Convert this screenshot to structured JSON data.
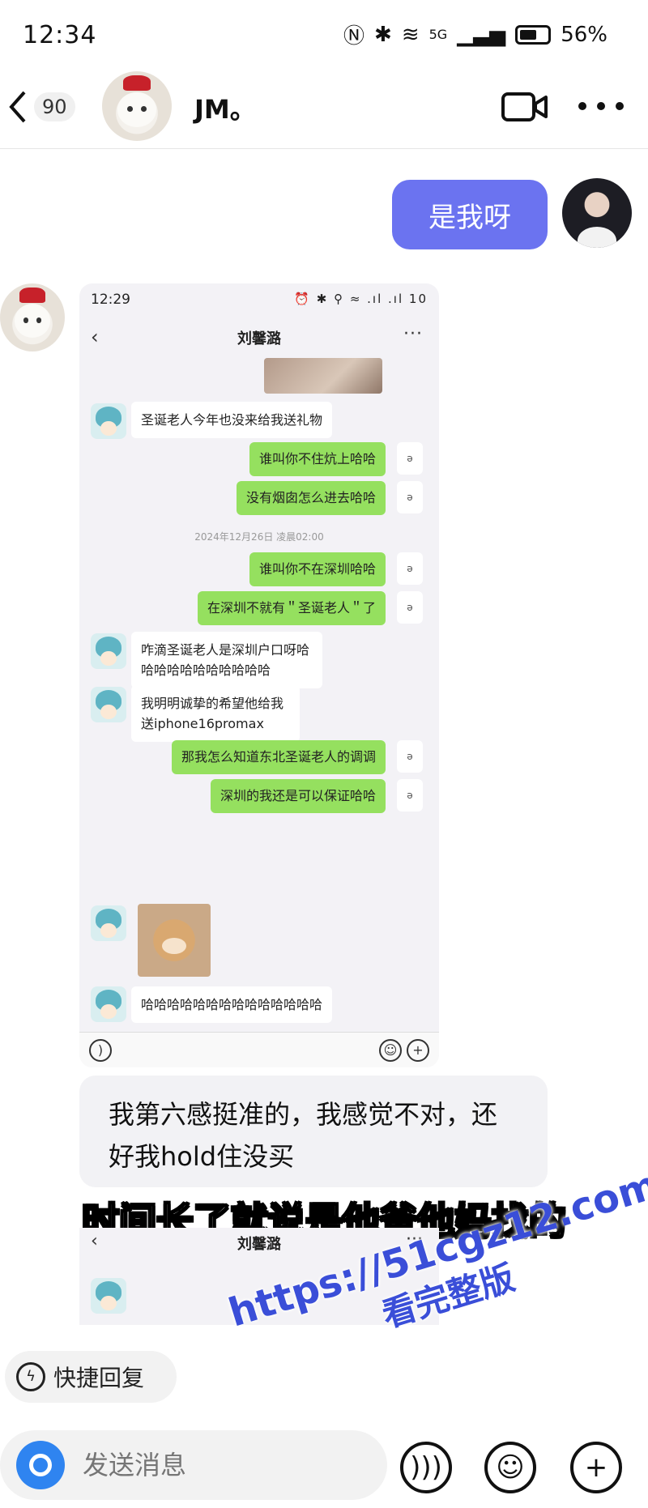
{
  "status_bar": {
    "time": "12:34",
    "battery": "56%",
    "network": "5G"
  },
  "header": {
    "back_count": "90",
    "contact_name": "JM。"
  },
  "messages": {
    "sent_text": "是我呀",
    "received_text": "我第六感挺准的，我感觉不对，还好我hold住没买",
    "subtitle": "时间长了就说是他爸他妈找的"
  },
  "embedded": {
    "time": "12:29",
    "status_right": "⏰ ✱ ⚲ ≈ .ıl .ıl 10",
    "title": "刘馨潞",
    "more": "···",
    "back": "‹",
    "read_mark": "ǝ",
    "timestamp": "2024年12月26日 凌晨02:00",
    "left_messages": [
      "圣诞老人今年也没来给我送礼物",
      "咋滴圣诞老人是深圳户口呀哈哈哈哈哈哈哈哈哈哈哈",
      "我明明诚挚的希望他给我送iphone16promax",
      "哈哈哈哈哈哈哈哈哈哈哈哈哈哈"
    ],
    "right_messages": [
      "谁叫你不住炕上哈哈",
      "没有烟囱怎么进去哈哈",
      "谁叫你不在深圳哈哈",
      "在深圳不就有＂圣诞老人＂了",
      "那我怎么知道东北圣诞老人的调调",
      "深圳的我还是可以保证哈哈"
    ]
  },
  "embedded_2": {
    "title": "刘馨潞",
    "more": "···",
    "back": "‹"
  },
  "quick_reply": {
    "label": "快捷回复"
  },
  "input_bar": {
    "placeholder": "发送消息"
  },
  "watermark": {
    "url": "https://51cgz12.com",
    "text": "看完整版"
  },
  "colors": {
    "sent_bubble": "#6b73f0",
    "embedded_green": "#95e05f",
    "camera_button": "#2f84f0",
    "watermark": "#3a4ed8"
  }
}
